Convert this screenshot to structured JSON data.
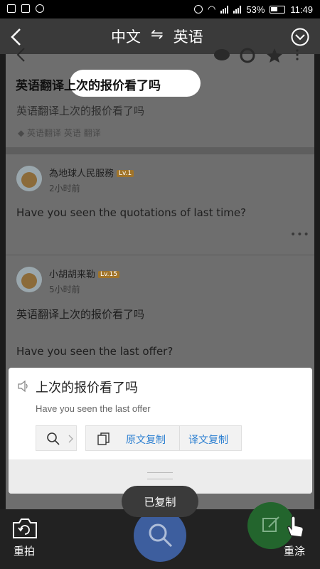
{
  "status_bar": {
    "battery": "53%",
    "time": "11:49"
  },
  "top_bar": {
    "source_lang": "中文",
    "swap_symbol": "⇋",
    "target_lang": "英语"
  },
  "question": {
    "title": "英语翻译上次的报价看了吗",
    "body": "英语翻译上次的报价看了吗",
    "tags": [
      "英语翻译",
      "英语",
      "翻译"
    ]
  },
  "answers": [
    {
      "user": "為地球人民服務",
      "level": "Lv.1",
      "time": "2小时前",
      "text": "Have you seen the quotations of last time?"
    },
    {
      "user": "小胡胡来勒",
      "level": "Lv.15",
      "time": "5小时前",
      "text_zh": "英语翻译上次的报价看了吗",
      "text": "Have you seen the last offer?"
    }
  ],
  "popup": {
    "source_text": "上次的报价看了吗",
    "translation": "Have you seen the last offer",
    "copy_source_label": "原文复制",
    "copy_translation_label": "译文复制"
  },
  "toast": "已复制",
  "bottom": {
    "retake_label": "重拍",
    "redraw_label": "重涂"
  },
  "colors": {
    "accent_blue": "#2b7fd1",
    "fab_search": "#3d5e9e",
    "fab_edit": "#23652d"
  }
}
